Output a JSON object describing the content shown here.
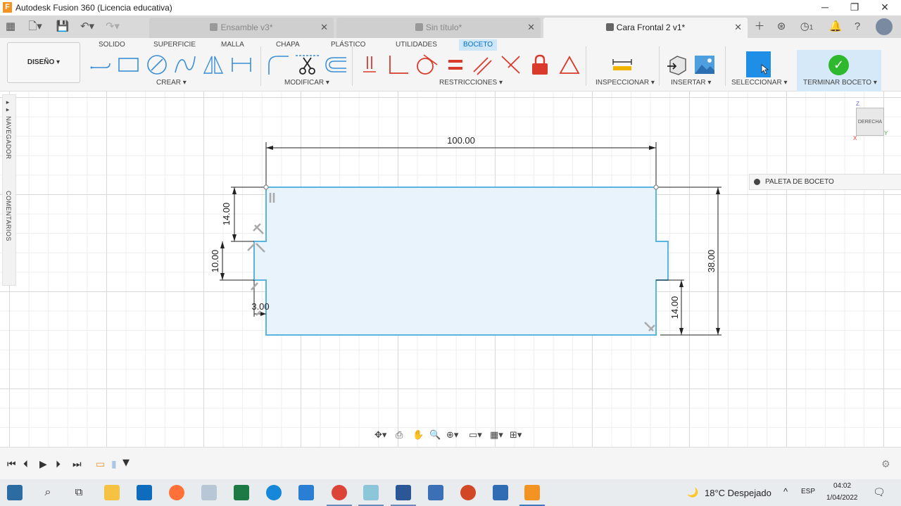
{
  "window": {
    "title": "Autodesk Fusion 360 (Licencia educativa)",
    "app_logo": "F"
  },
  "tabs": [
    {
      "label": "Ensamble v3*",
      "active": false
    },
    {
      "label": "Sin título*",
      "active": false
    },
    {
      "label": "Cara Frontal 2 v1*",
      "active": true
    }
  ],
  "tabbar": {
    "notifications_count": "1"
  },
  "toolbar": {
    "workspace": "DISEÑO ▾",
    "workspace_tabs": [
      "SOLIDO",
      "SUPERFICIE",
      "MALLA",
      "CHAPA",
      "PLÁSTICO",
      "UTILIDADES",
      "BOCETO"
    ],
    "active_tab": "BOCETO",
    "groups": {
      "crear": "CREAR ▾",
      "modificar": "MODIFICAR ▾",
      "restricciones": "RESTRICCIONES ▾",
      "inspeccionar": "INSPECCIONAR ▾",
      "insertar": "INSERTAR ▾",
      "seleccionar": "SELECCIONAR ▾",
      "terminar": "TERMINAR BOCETO ▾"
    }
  },
  "side_panel": {
    "navegador": "NAVEGADOR",
    "comentarios": "COMENTARIOS"
  },
  "sketch_palette": {
    "label": "PALETA DE BOCETO"
  },
  "viewcube": {
    "face": "DERECHA",
    "axis_z": "Z",
    "axis_y": "Y",
    "axis_x": "X"
  },
  "sketch": {
    "dimensions": {
      "width": "100.00",
      "height": "38.00",
      "top_left_segment": "14.00",
      "notch_left": "10.00",
      "notch_depth": "3.00",
      "bottom_right_segment": "14.00"
    }
  },
  "taskbar": {
    "weather": "18°C  Despejado",
    "language": "ESP",
    "time": "04:02",
    "date": "1/04/2022"
  },
  "colors": {
    "accent": "#0072c6",
    "sketch_line": "#5ab4e0",
    "sketch_fill": "#e8f3fb",
    "finish_check": "#2eb82e"
  }
}
